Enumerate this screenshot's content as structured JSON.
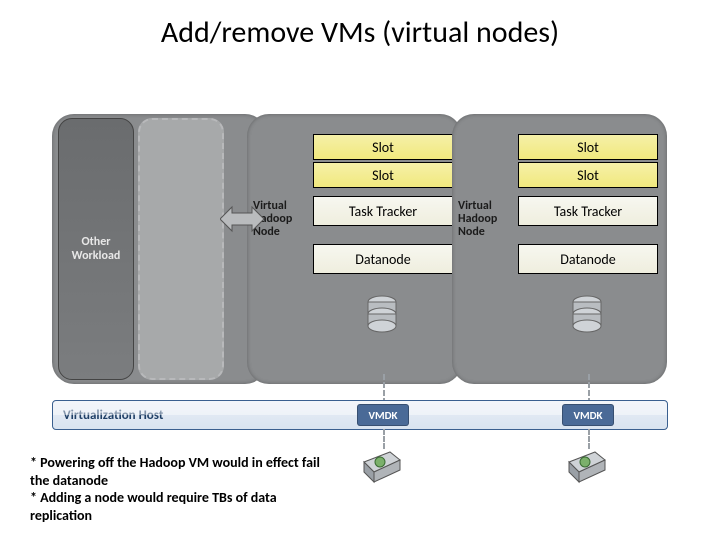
{
  "title": "Add/remove VMs (virtual nodes)",
  "labels": {
    "other_workload": "Other Workload",
    "vhn": "Virtual Hadoop Node",
    "slot": "Slot",
    "task_tracker": "Task Tracker",
    "datanode": "Datanode",
    "virtualization_host": "Virtualization Host",
    "vmdk": "VMDK"
  },
  "footnotes": {
    "l1": "* Powering off the Hadoop VM would in effect fail the datanode",
    "l2": "* Adding a node would require TBs of data replication"
  }
}
